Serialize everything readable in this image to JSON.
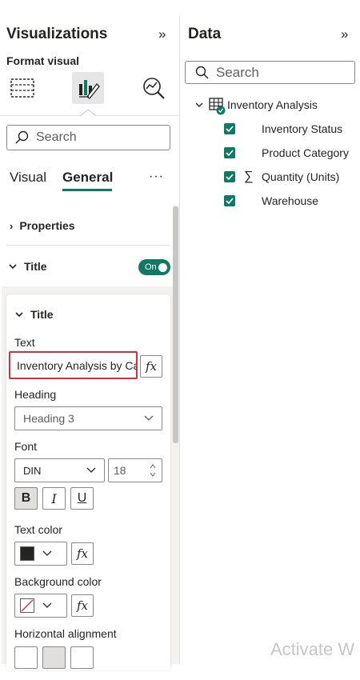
{
  "visualizations": {
    "title": "Visualizations",
    "collapse_icon": "double-chevron-right-icon",
    "format_visual_label": "Format visual",
    "icons": [
      "add-visual-icon",
      "format-visual-icon",
      "analytics-icon"
    ],
    "search_placeholder": "Search",
    "tabs": [
      {
        "label": "Visual",
        "active": false
      },
      {
        "label": "General",
        "active": true
      }
    ],
    "more_label": "···",
    "sections": {
      "properties": "Properties",
      "title": "Title",
      "title_toggle": "On"
    },
    "title_card": {
      "header": "Title",
      "text_label": "Text",
      "text_value": "Inventory Analysis by Category",
      "heading_label": "Heading",
      "heading_value": "Heading 3",
      "font_label": "Font",
      "font_family": "DIN",
      "font_size": "18",
      "bold": "B",
      "italic": "I",
      "underline": "U",
      "text_color_label": "Text color",
      "text_color": "#252423",
      "background_color_label": "Background color",
      "horizontal_alignment_label": "Horizontal alignment",
      "fx_label": "fx"
    }
  },
  "data_pane": {
    "title": "Data",
    "collapse_icon": "double-chevron-right-icon",
    "search_placeholder": "Search",
    "table_name": "Inventory Analysis",
    "fields": [
      {
        "label": "Inventory Status",
        "checked": true,
        "sigma": false
      },
      {
        "label": "Product Category",
        "checked": true,
        "sigma": false
      },
      {
        "label": "Quantity (Units)",
        "checked": true,
        "sigma": true
      },
      {
        "label": "Warehouse",
        "checked": true,
        "sigma": false
      }
    ],
    "sigma_symbol": "∑"
  },
  "watermark": "Activate W",
  "colors": {
    "accent": "#117865",
    "highlight": "#d13438"
  }
}
